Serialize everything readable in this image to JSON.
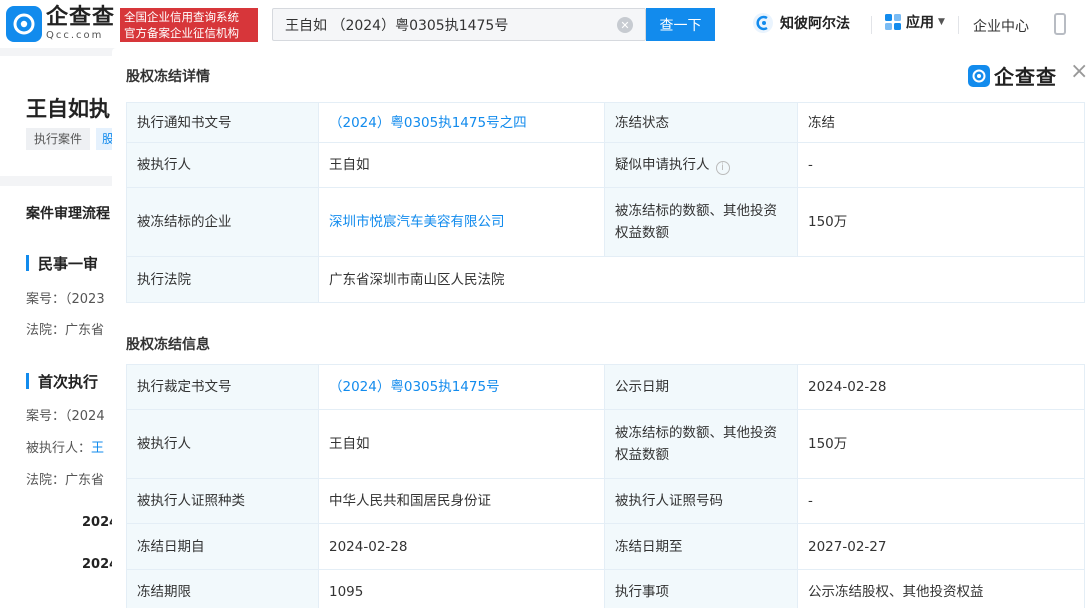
{
  "header": {
    "logo_cn": "企查查",
    "logo_en": "Qcc.com",
    "slogan_line1": "全国企业信用查询系统",
    "slogan_line2": "官方备案企业征信机构",
    "search_value": "王自如 （2024）粤0305执1475号",
    "search_button": "查一下",
    "nav_alpha": "知彼阿尔法",
    "nav_app": "应用",
    "nav_center": "企业中心"
  },
  "background": {
    "title": "王自如执",
    "tag1": "执行案件",
    "tag2": "股",
    "process_title": "案件审理流程",
    "stage1": "民事一审",
    "case_no_label": "案号：",
    "case_no_1": "（2023",
    "court_label": "法院：",
    "court_1": "广东省",
    "stage2": "首次执行",
    "case_no_2": "（2024",
    "executed_label": "被执行人：",
    "executed_name": "王",
    "court_2": "广东省",
    "year_1": "2024",
    "year_2": "2024"
  },
  "modal": {
    "title": "股权冻结详情",
    "logo": "企查查",
    "close": "×",
    "section2_title": "股权冻结信息",
    "detail": {
      "notice_no_label": "执行通知书文号",
      "notice_no": "（2024）粤0305执1475号之四",
      "status_label": "冻结状态",
      "status": "冻结",
      "executed_label": "被执行人",
      "executed": "王自如",
      "applicant_label": "疑似申请执行人",
      "applicant": "-",
      "company_label": "被冻结标的企业",
      "company": "深圳市悦宸汽车美容有限公司",
      "amount_label": "被冻结标的数额、其他投资权益数额",
      "amount": "150万",
      "court_label": "执行法院",
      "court": "广东省深圳市南山区人民法院"
    },
    "info": {
      "ruling_no_label": "执行裁定书文号",
      "ruling_no": "（2024）粤0305执1475号",
      "publish_date_label": "公示日期",
      "publish_date": "2024-02-28",
      "executed_label": "被执行人",
      "executed": "王自如",
      "amount_label": "被冻结标的数额、其他投资权益数额",
      "amount": "150万",
      "id_type_label": "被执行人证照种类",
      "id_type": "中华人民共和国居民身份证",
      "id_no_label": "被执行人证照号码",
      "id_no": "-",
      "from_label": "冻结日期自",
      "from": "2024-02-28",
      "to_label": "冻结日期至",
      "to": "2027-02-27",
      "term_label": "冻结期限",
      "term": "1095",
      "matter_label": "执行事项",
      "matter": "公示冻结股权、其他投资权益"
    }
  }
}
